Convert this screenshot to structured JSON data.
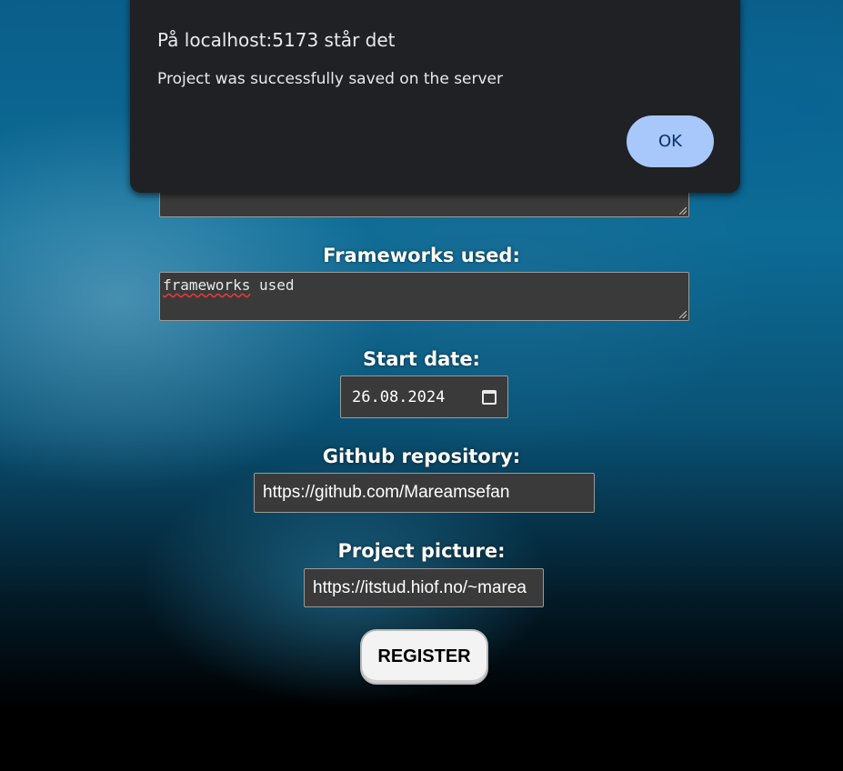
{
  "form": {
    "frameworks_label": "Frameworks used:",
    "frameworks_value_word1": "frameworks",
    "frameworks_value_word2": " used",
    "start_date_label": "Start date:",
    "start_date_value": "26.08.2024",
    "github_label": "Github repository:",
    "github_value": "https://github.com/Mareamsefan",
    "picture_label": "Project picture:",
    "picture_value": "https://itstud.hiof.no/~marea",
    "register_label": "REGISTER"
  },
  "dialog": {
    "title": "På localhost:5173 står det",
    "message": "Project was successfully saved on the server",
    "ok_label": "OK",
    "ok_color": "#a8c7fa",
    "background": "#202124"
  },
  "icons": {
    "date_picker": "calendar-icon",
    "resize_handle": "resize-grip-icon"
  }
}
